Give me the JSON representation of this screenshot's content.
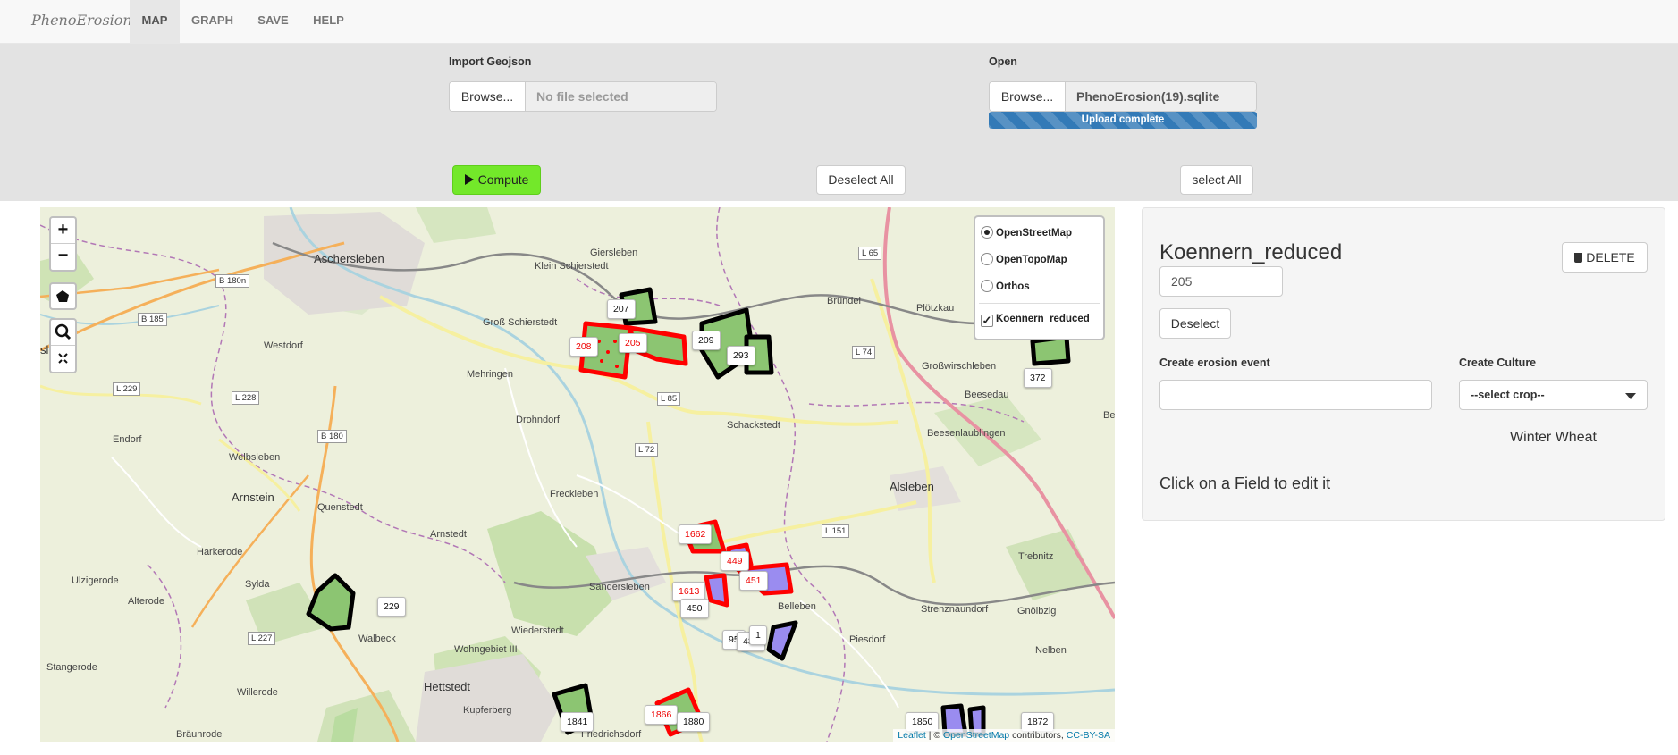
{
  "navbar": {
    "brand": "PhenoErosion",
    "items": [
      {
        "label": "MAP",
        "active": true
      },
      {
        "label": "GRAPH",
        "active": false
      },
      {
        "label": "SAVE",
        "active": false
      },
      {
        "label": "HELP",
        "active": false
      }
    ]
  },
  "import_geojson": {
    "label": "Import Geojson",
    "browse_label": "Browse...",
    "file_text": "No file selected"
  },
  "open_file": {
    "label": "Open",
    "browse_label": "Browse...",
    "file_text": "PhenoErosion(19).sqlite",
    "progress_text": "Upload complete",
    "progress_fraction": 1.0
  },
  "actions": {
    "compute_label": "Compute",
    "deselect_all_label": "Deselect All",
    "select_all_label": "select All"
  },
  "map": {
    "zoom_in": "+",
    "zoom_out": "−",
    "layers": [
      {
        "label": "OpenStreetMap",
        "type": "radio",
        "checked": true
      },
      {
        "label": "OpenTopoMap",
        "type": "radio",
        "checked": false
      },
      {
        "label": "Orthos",
        "type": "radio",
        "checked": false
      },
      {
        "label": "Koennern_reduced",
        "type": "checkbox",
        "checked": true
      }
    ],
    "places": [
      "Aschersleben",
      "Giersleben",
      "Klein Schierstedt",
      "Groß Schierstedt",
      "Westdorf",
      "Mehringen",
      "Drohndorf",
      "Schackstedt",
      "Bründel",
      "Plötzkau",
      "Großwirschleben",
      "Beesedau",
      "Beesenlaublingen",
      "Endorf",
      "Welbsleben",
      "Arnstein",
      "Quenstedt",
      "Harkerode",
      "Ulzigerode",
      "Sylda",
      "Alterode",
      "Stangerode",
      "Willerode",
      "Walbeck",
      "Arnstedt",
      "Freckleben",
      "Sandersleben",
      "Alsleben",
      "Belleben",
      "Piesdorf",
      "Strenznaundorf",
      "Gnölbzig",
      "Trebnitz",
      "Nelben",
      "Wiederstedt",
      "Wohngebiet III",
      "Hettstedt",
      "Kupferberg",
      "Bräunrode",
      "Friedrichsdorf",
      "Be",
      "sleben"
    ],
    "roads": [
      "B 180n",
      "B 185",
      "L 229",
      "L 228",
      "B 180",
      "L 65",
      "L 74",
      "L 85",
      "L 72",
      "L 151",
      "L 227"
    ],
    "field_markers": [
      {
        "label": "207",
        "red": false
      },
      {
        "label": "208",
        "red": true
      },
      {
        "label": "205",
        "red": true
      },
      {
        "label": "209",
        "red": false
      },
      {
        "label": "293",
        "red": false
      },
      {
        "label": "372",
        "red": false
      },
      {
        "label": "1662",
        "red": true
      },
      {
        "label": "449",
        "red": true
      },
      {
        "label": "451",
        "red": true
      },
      {
        "label": "1613",
        "red": true
      },
      {
        "label": "450",
        "red": false
      },
      {
        "label": "229",
        "red": false
      },
      {
        "label": "95",
        "red": false
      },
      {
        "label": "438",
        "red": false
      },
      {
        "label": "1",
        "red": false
      },
      {
        "label": "1841",
        "red": false
      },
      {
        "label": "1866",
        "red": true
      },
      {
        "label": "1880",
        "red": false
      },
      {
        "label": "1850",
        "red": false
      },
      {
        "label": "1872",
        "red": false
      }
    ],
    "attribution": {
      "leaflet": "Leaflet",
      "sep": " | © ",
      "osm": "OpenStreetMap",
      "contrib": " contributors, ",
      "license": "CC-BY-SA"
    }
  },
  "side_panel": {
    "title": "Koennern_reduced",
    "delete_label": "DELETE",
    "field_id": "205",
    "deselect_label": "Deselect",
    "erosion_label": "Create erosion event",
    "erosion_value": "",
    "culture_label": "Create Culture",
    "culture_select": "--select crop--",
    "culture_value": "Winter Wheat",
    "hint": "Click on a Field to edit it"
  }
}
